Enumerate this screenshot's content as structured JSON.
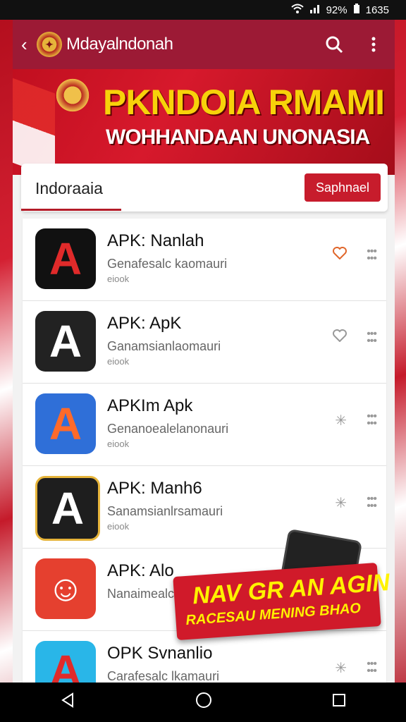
{
  "status": {
    "wifi_icon": "wifi-icon",
    "signal_icon": "signal-icon",
    "battery_text": "92%",
    "time": "1635"
  },
  "app_bar": {
    "back_icon": "back-arrow-icon",
    "logo_icon": "garuda-logo-icon",
    "title": "Mdayalndonah",
    "search_icon": "search-icon",
    "menu_icon": "more-vert-icon"
  },
  "banner": {
    "title": "PKNDOIA RMAMI",
    "subtitle": "WOHHANDAAN UNONASIA"
  },
  "tabs": {
    "active_label": "Indoraaia",
    "button_label": "Saphnael"
  },
  "apps": [
    {
      "title": "APK: Nanlah",
      "subtitle": "Genafesalc kaomauri",
      "meta": "eiook",
      "icon": "a-black-icon",
      "action_icon": "heart-icon"
    },
    {
      "title": "APK: ApK",
      "subtitle": "Ganamsianlaomauri",
      "meta": "eiook",
      "icon": "a-dark-icon",
      "action_icon": "heart-icon"
    },
    {
      "title": "APKIm Apk",
      "subtitle": "Genanoealelanonauri",
      "meta": "eiook",
      "icon": "a-blue-icon",
      "action_icon": "sparkle-icon"
    },
    {
      "title": "APK: Manh6",
      "subtitle": "Sanamsianlrsamauri",
      "meta": "eiook",
      "icon": "a-gold-icon",
      "action_icon": "sparkle-icon"
    },
    {
      "title": "APK: Alo",
      "subtitle": "Nanaimealc",
      "meta": "",
      "icon": "ghost-red-icon",
      "action_icon": ""
    },
    {
      "title": "OPK Svnanlio",
      "subtitle": "Carafesalc lkamauri",
      "meta": "",
      "icon": "a-cyan-icon",
      "action_icon": "sparkle-icon"
    }
  ],
  "promo": {
    "title": "NAV GR AN AGIN",
    "subtitle": "RACESAU MENING BHAO"
  },
  "nav": {
    "back": "back-nav-icon",
    "home": "home-nav-icon",
    "recents": "recents-nav-icon"
  },
  "colors": {
    "app_bar": "#9c1a35",
    "accent": "#c71c2c",
    "banner_title": "#f7d20a"
  }
}
